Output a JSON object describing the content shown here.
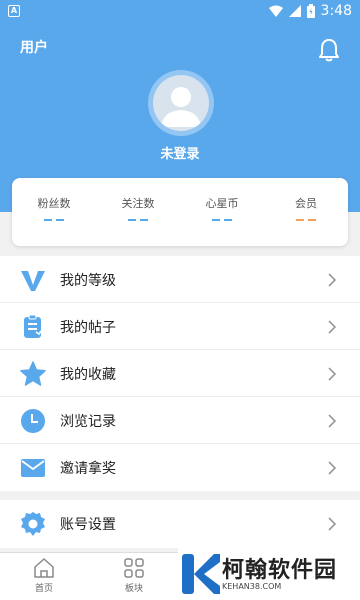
{
  "status_bar": {
    "notification_icon": "A",
    "time": "3:48"
  },
  "header": {
    "title": "用户"
  },
  "profile": {
    "login_status": "未登录"
  },
  "stats": [
    {
      "label": "粉丝数",
      "value": "--",
      "color": "#5aa8ec"
    },
    {
      "label": "关注数",
      "value": "--",
      "color": "#5aa8ec"
    },
    {
      "label": "心星币",
      "value": "--",
      "color": "#5aa8ec"
    },
    {
      "label": "会员",
      "value": "--",
      "color": "#f5a05a"
    }
  ],
  "menu": [
    {
      "label": "我的等级",
      "icon": "vip-level-icon"
    },
    {
      "label": "我的帖子",
      "icon": "posts-icon"
    },
    {
      "label": "我的收藏",
      "icon": "star-icon"
    },
    {
      "label": "浏览记录",
      "icon": "clock-icon"
    },
    {
      "label": "邀请拿奖",
      "icon": "envelope-icon"
    }
  ],
  "settings": {
    "label": "账号设置",
    "icon": "gear-icon"
  },
  "tabbar": [
    {
      "label": "首页",
      "icon": "home-icon"
    },
    {
      "label": "板块",
      "icon": "grid-icon"
    }
  ],
  "watermark": {
    "text": "柯翰软件园",
    "url": "KEHAN38.COM"
  },
  "colors": {
    "accent": "#5aa8ec",
    "member": "#f5a05a"
  }
}
